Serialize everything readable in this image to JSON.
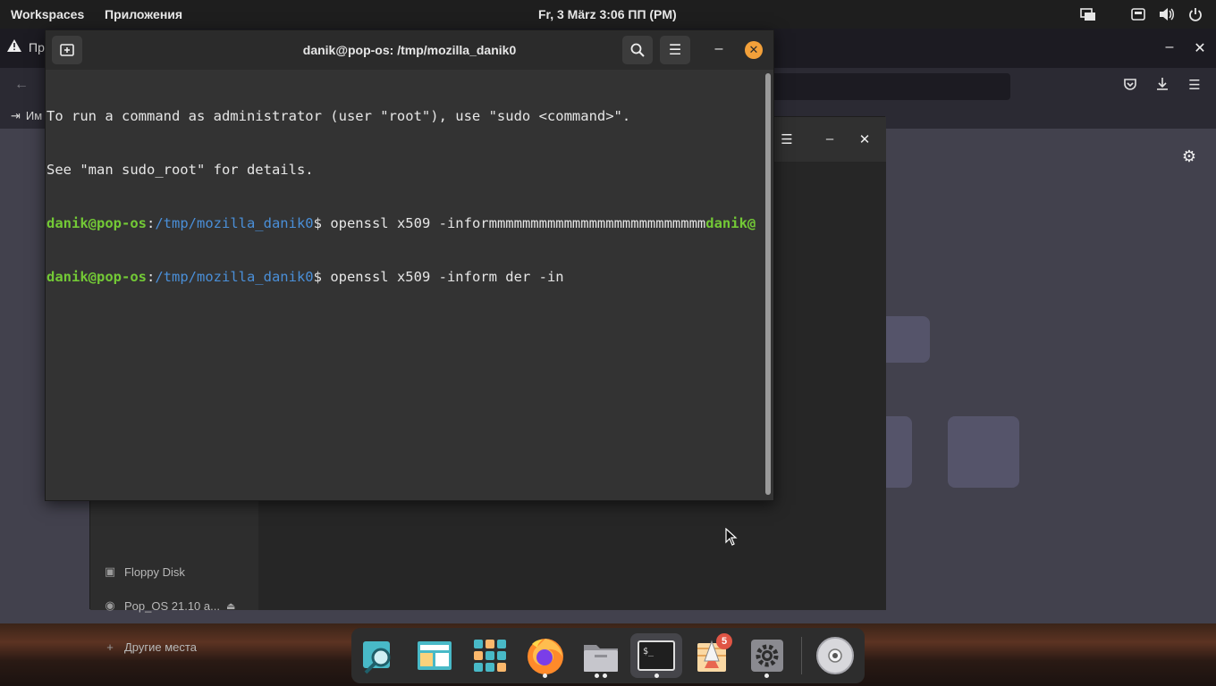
{
  "top_panel": {
    "workspaces": "Workspaces",
    "applications": "Приложения",
    "clock": "Fr, 3 März   3:06 ПП (PM)"
  },
  "firefox": {
    "tab_title": "Пр",
    "bookmark": "Им"
  },
  "files": {
    "sidebar": [
      {
        "label": "Floppy Disk",
        "icon": "floppy-icon"
      },
      {
        "label": "Pop_OS 21.10 a...",
        "icon": "disc-icon"
      },
      {
        "label": "Другие места",
        "icon": "plus-icon"
      }
    ]
  },
  "terminal": {
    "title": "danik@pop-os: /tmp/mozilla_danik0",
    "lines": [
      "To run a command as administrator (user \"root\"), use \"sudo <command>\".",
      "See \"man sudo_root\" for details."
    ],
    "prompt_user": "danik@pop-os",
    "prompt_sep": ":",
    "prompt_path": "/tmp/mozilla_danik0",
    "prompt_dollar": "$ ",
    "cmd1": "openssl x509 -informmmmmmmmmmmmmmmmmmmmmmmmmm",
    "cmd1_trailing_user": "danik@",
    "cmd2": "openssl x509 -inform der -in"
  },
  "dock": {
    "items": [
      {
        "name": "search-app-icon"
      },
      {
        "name": "files-app-icon"
      },
      {
        "name": "app-grid-icon"
      },
      {
        "name": "firefox-icon"
      },
      {
        "name": "file-manager-icon"
      },
      {
        "name": "terminal-icon"
      },
      {
        "name": "pop-shop-icon",
        "badge": "5"
      },
      {
        "name": "settings-icon"
      },
      {
        "name": "disc-drive-icon"
      }
    ]
  },
  "colors": {
    "prompt_user": "#73c936",
    "prompt_path": "#4a8fd8",
    "close_accent": "#f2a03a",
    "badge": "#e05545"
  }
}
